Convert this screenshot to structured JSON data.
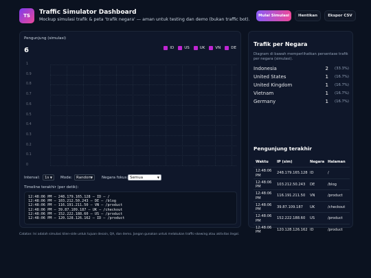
{
  "header": {
    "logo_text": "TS",
    "title": "Traffic Simulator Dashboard",
    "subtitle": "Mockup simulasi trafik & peta 'trafik negara' — aman untuk testing dan demo (bukan traffic bot).",
    "start_label": "Mulai Simulasi",
    "stop_label": "Hentikan",
    "export_label": "Ekspor CSV",
    "accent_gradient": [
      "#8b5cf6",
      "#ec4899"
    ]
  },
  "visitors": {
    "label": "Pengunjung (simulasi)",
    "value": "6"
  },
  "legend": [
    "ID",
    "US",
    "UK",
    "VN",
    "DE"
  ],
  "chart_data": {
    "type": "line",
    "y_ticks": [
      "1",
      "0.9",
      "0.8",
      "0.7",
      "0.6",
      "0.5",
      "0.4",
      "0.3",
      "0.2",
      "0.1",
      "0"
    ],
    "ylim": [
      0,
      1
    ],
    "grid": true,
    "legend_position": "top-right",
    "series": [
      {
        "name": "ID",
        "values": []
      },
      {
        "name": "US",
        "values": []
      },
      {
        "name": "UK",
        "values": []
      },
      {
        "name": "VN",
        "values": []
      },
      {
        "name": "DE",
        "values": []
      }
    ],
    "series_color": "#c026d3"
  },
  "controls": {
    "interval_label": "Interval:",
    "interval_value": "1s",
    "mode_label": "Mode:",
    "mode_value": "Random",
    "focus_label": "Negara fokus:",
    "focus_value": "Semua"
  },
  "timeline": {
    "label": "Timeline terakhir (per detik):",
    "lines": [
      "12:48:06 PM — 248.179.165.128 — ID — /",
      "12:48:06 PM — 103.212.50.243 — DE — /blog",
      "12:48:06 PM — 116.191.211.50 — VN — /product",
      "12:48:06 PM — 39.87.109.187 — UK — /checkout",
      "12:48:06 PM — 152.222.188.60 — US — /product",
      "12:48:06 PM — 120.128.126.162 — ID — /product"
    ]
  },
  "countries": {
    "title": "Trafik per Negara",
    "description": "Diagram di bawah memperlihatkan persentase trafik per negara (simulasi).",
    "rows": [
      {
        "name": "Indonesia",
        "count": "2",
        "pct": "(33.3%)"
      },
      {
        "name": "United States",
        "count": "1",
        "pct": "(16.7%)"
      },
      {
        "name": "United Kingdom",
        "count": "1",
        "pct": "(16.7%)"
      },
      {
        "name": "Vietnam",
        "count": "1",
        "pct": "(16.7%)"
      },
      {
        "name": "Germany",
        "count": "1",
        "pct": "(16.7%)"
      }
    ]
  },
  "recent": {
    "title": "Pengunjung terakhir",
    "headers": [
      "Waktu",
      "IP (sim)",
      "Negara",
      "Halaman"
    ],
    "rows": [
      {
        "time": "12:48:06 PM",
        "ip": "248.179.165.128",
        "country": "ID",
        "page": "/"
      },
      {
        "time": "12:48:06 PM",
        "ip": "103.212.50.243",
        "country": "DE",
        "page": "/blog"
      },
      {
        "time": "12:48:06 PM",
        "ip": "116.191.211.50",
        "country": "VN",
        "page": "/product"
      },
      {
        "time": "12:48:06 PM",
        "ip": "39.87.109.187",
        "country": "UK",
        "page": "/checkout"
      },
      {
        "time": "12:48:06 PM",
        "ip": "152.222.188.60",
        "country": "US",
        "page": "/product"
      },
      {
        "time": "12:48:06 PM",
        "ip": "120.128.126.162",
        "country": "ID",
        "page": "/product"
      }
    ]
  },
  "footer": {
    "note": "Catatan: Ini adalah simulasi klien-side untuk tujuan desain, QA, dan demo. Jangan gunakan untuk melakukan traffic-skewing atau aktivitas ilegal."
  }
}
